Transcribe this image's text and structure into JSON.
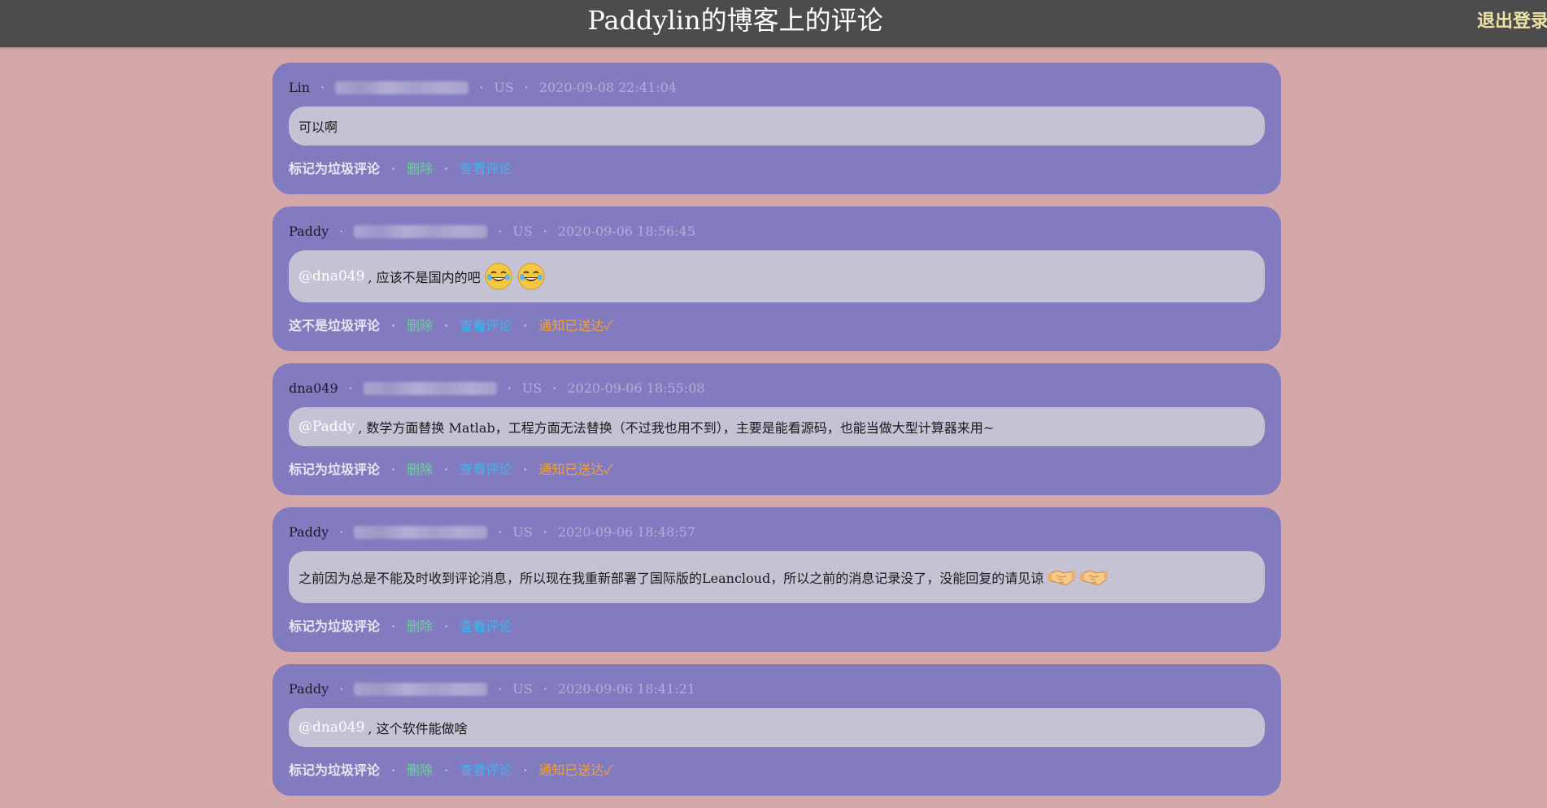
{
  "header": {
    "title": "Paddylin的博客上的评论",
    "logout_label": "退出登录"
  },
  "comments": [
    {
      "author": "Lin",
      "country": "US",
      "time": "2020-09-08 22:41:04",
      "mention": "",
      "text": "可以啊",
      "spam_label": "标记为垃圾评论",
      "delete_label": "删除",
      "view_label": "查看评论",
      "notify_label": ""
    },
    {
      "author": "Paddy",
      "country": "US",
      "time": "2020-09-06 18:56:45",
      "mention": "@dna049",
      "text": " , 应该不是国内的吧",
      "emoji": [
        "rofl-emoji",
        "rofl-emoji"
      ],
      "spam_label": "这不是垃圾评论",
      "delete_label": "删除",
      "view_label": "查看评论",
      "notify_label": "通知已送达✓"
    },
    {
      "author": "dna049",
      "country": "US",
      "time": "2020-09-06 18:55:08",
      "mention": "@Paddy",
      "text": " , 数学方面替换 Matlab，工程方面无法替换（不过我也用不到），主要是能看源码，也能当做大型计算器来用~",
      "spam_label": "标记为垃圾评论",
      "delete_label": "删除",
      "view_label": "查看评论",
      "notify_label": "通知已送达✓"
    },
    {
      "author": "Paddy",
      "country": "US",
      "time": "2020-09-06 18:48:57",
      "mention": "",
      "text": "之前因为总是不能及时收到评论消息，所以现在我重新部署了国际版的Leancloud，所以之前的消息记录没了，没能回复的请见谅",
      "emoji": [
        "handshake-emoji",
        "handshake-emoji"
      ],
      "spam_label": "标记为垃圾评论",
      "delete_label": "删除",
      "view_label": "查看评论",
      "notify_label": ""
    },
    {
      "author": "Paddy",
      "country": "US",
      "time": "2020-09-06 18:41:21",
      "mention": "@dna049",
      "text": " , 这个软件能做啥",
      "spam_label": "标记为垃圾评论",
      "delete_label": "删除",
      "view_label": "查看评论",
      "notify_label": "通知已送达✓"
    }
  ]
}
